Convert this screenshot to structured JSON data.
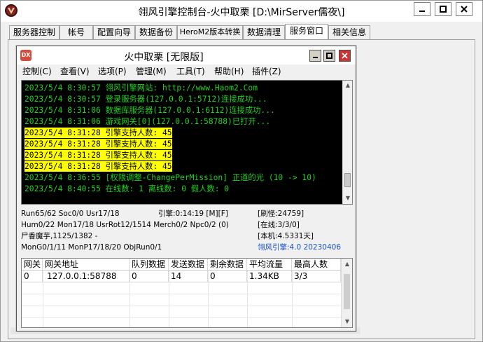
{
  "window": {
    "title": "翎风引擎控制台-火中取栗 [D:\\MirServer儒夜\\]"
  },
  "tabs": [
    {
      "label": "服务器控制"
    },
    {
      "label": "帐号"
    },
    {
      "label": "配置向导"
    },
    {
      "label": "数据备份"
    },
    {
      "label": "HeroM2版本转换"
    },
    {
      "label": "数据清理"
    },
    {
      "label": "服务窗口"
    },
    {
      "label": "相关信息"
    }
  ],
  "inner_window": {
    "logo_text": "DX",
    "title": "火中取栗 [无限版]"
  },
  "menu": [
    {
      "label": "控制(C)"
    },
    {
      "label": "查看(V)"
    },
    {
      "label": "选项(P)"
    },
    {
      "label": "管理(M)"
    },
    {
      "label": "工具(T)"
    },
    {
      "label": "帮助(H)"
    },
    {
      "label": "插件(Z)"
    }
  ],
  "log": [
    {
      "text": "2023/5/4 8:30:57 翎风引擎网站: http://www.Haom2.Com",
      "highlight": false
    },
    {
      "text": "2023/5/4 8:30:57 登录服务器(127.0.0.1:5712)连接成功...",
      "highlight": false
    },
    {
      "text": "2023/5/4 8:31:06 数据库服务器(127.0.0.1:6112)连接成功...",
      "highlight": false
    },
    {
      "text": "2023/5/4 8:31:06 游戏网关[0](127.0.0.1:58788)已打开...",
      "highlight": false
    },
    {
      "text": "2023/5/4 8:31:28 引擎支持人数: 45",
      "highlight": true
    },
    {
      "text": "2023/5/4 8:31:28 引擎支持人数: 45",
      "highlight": true
    },
    {
      "text": "2023/5/4 8:31:28 引擎支持人数: 45",
      "highlight": true
    },
    {
      "text": "2023/5/4 8:31:28 引擎支持人数: 45",
      "highlight": true
    },
    {
      "text": "2023/5/4 8:36:55 [权限调整-ChangePerMission] 正道的光 (10 -> 10)",
      "highlight": false
    },
    {
      "text": "2023/5/4 8:40:55 在线数: 1 离线数: 0 假人数: 0",
      "highlight": false
    }
  ],
  "status": {
    "run": "Run65/62 Soc0/0 Usr17/18",
    "engine_time": "引擎:0:14:19 [M][F]",
    "monsters": "[刷怪:24759]",
    "hum": "Hum0/22 Mon17/18 UsrRot12/1514 Merch0/2 Npc0/2 (0)",
    "online": "[在线:3/3/0]",
    "map": "尸香魔芋,1125/1382 -",
    "local": "[本机:4.5331天]",
    "monrun": "MonG0/1/11 MonP17/18/20 ObjRun0/1",
    "version": "翎风引擎:4.0 20230406"
  },
  "gateway_table": {
    "headers": [
      "网关",
      "网关地址",
      "队列数据",
      "发送数据",
      "剩余数据",
      "平均流量",
      "最高人数"
    ],
    "rows": [
      [
        "0",
        "127.0.0.1:58788",
        "0",
        "14",
        "0",
        "1.34KB",
        "3/3"
      ]
    ]
  },
  "colors": {
    "console_bg": "#000000",
    "console_text": "#1fd31f",
    "highlight_bg": "#ffff00",
    "version_text": "#1a4fcf",
    "close_button": "#cc3333"
  }
}
